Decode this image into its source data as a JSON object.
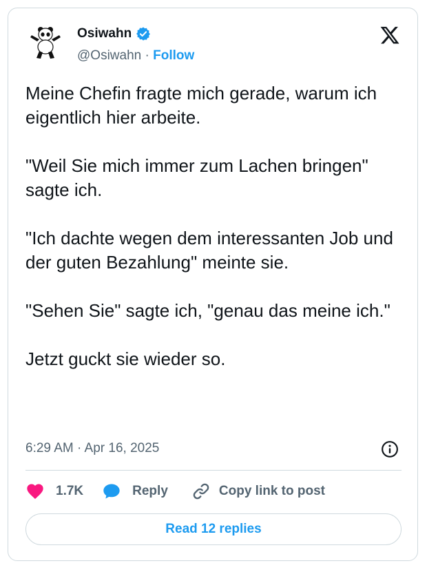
{
  "author": {
    "name": "Osiwahn",
    "handle": "@Osiwahn",
    "separator": "·",
    "follow_label": "Follow",
    "verified": true
  },
  "post": {
    "text": "Meine Chefin fragte mich gerade, warum ich eigentlich hier arbeite.\n\n\"Weil Sie mich immer zum Lachen bringen\" sagte ich.\n\n\"Ich dachte wegen dem interessanten Job und der guten Bezahlung\" meinte sie.\n\n\"Sehen Sie\" sagte ich, \"genau das meine ich.\"\n\nJetzt guckt sie wieder so.",
    "timestamp": "6:29 AM · Apr 16, 2025"
  },
  "actions": {
    "like_count": "1.7K",
    "reply_label": "Reply",
    "copy_link_label": "Copy link to post"
  },
  "read_replies_label": "Read 12 replies",
  "icons": {
    "platform": "x-logo-icon",
    "verified": "verified-badge-icon",
    "info": "info-icon",
    "like": "heart-icon",
    "reply": "chat-bubble-icon",
    "copy": "link-icon"
  },
  "colors": {
    "accent": "#1d9bf0",
    "like": "#f91880",
    "text": "#0f1419",
    "muted": "#536471",
    "border": "#cfd9de"
  }
}
